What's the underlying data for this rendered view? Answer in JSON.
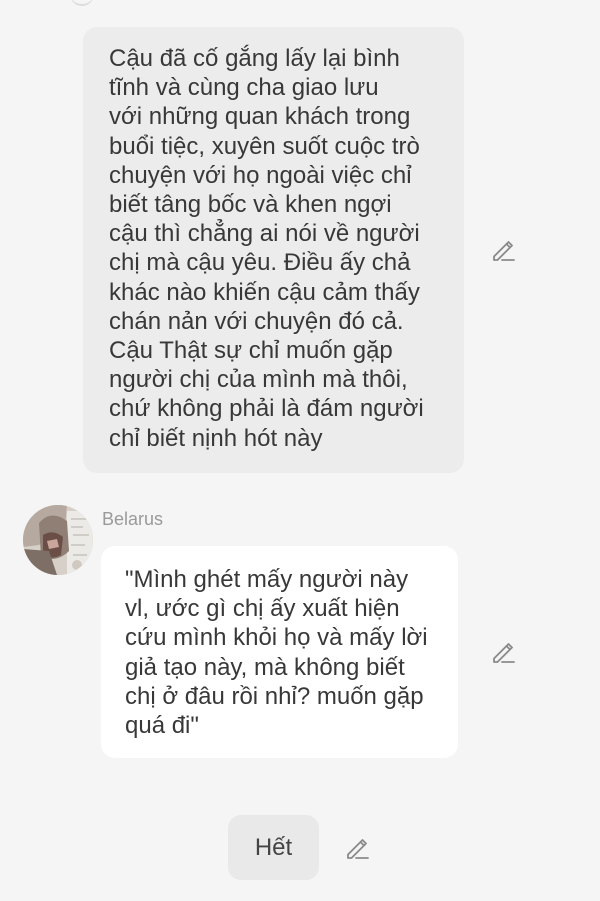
{
  "narration": {
    "text": "Cậu đã cố gắng lấy lại bình\ntĩnh và cùng cha giao lưu\nvới những quan khách trong\nbuổi tiệc, xuyên suốt cuộc trò\nchuyện với họ ngoài việc chỉ\nbiết tâng bốc và khen ngợi\ncậu thì chẳng ai nói về người\nchị mà cậu yêu. Điều ấy chả\nkhác nào khiến cậu cảm thấy\nchán nản với chuyện đó cả.\nCậu Thật sự chỉ muốn gặp\nngười chị của mình mà thôi,\nchứ không phải là đám người\nchỉ biết nịnh hót này"
  },
  "message": {
    "speaker": "Belarus",
    "text": "\"Mình ghét mấy người này\nvl, ước gì chị ấy xuất hiện\ncứu mình khỏi họ và mấy lời\ngiả tạo này, mà không biết\nchị ở đâu rồi nhỉ? muốn gặp\nquá đi\""
  },
  "end_button": {
    "label": "Hết"
  },
  "icons": {
    "edit": "pencil-edit-icon",
    "avatar": "character-avatar"
  },
  "colors": {
    "background": "#f5f5f5",
    "narration_bubble": "#ececec",
    "speech_bubble": "#ffffff",
    "text": "#383838",
    "speaker_name": "#9a9a9a",
    "icon": "#8a8a8a"
  }
}
